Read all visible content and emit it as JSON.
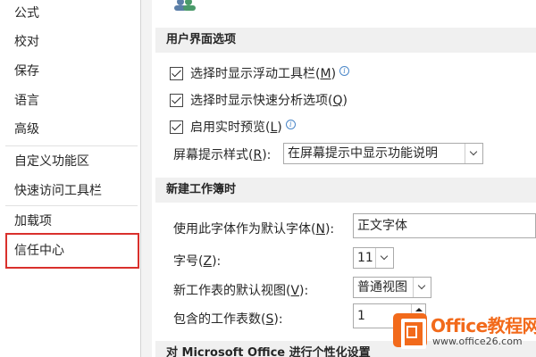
{
  "sidebar": {
    "items": [
      {
        "label": "公式"
      },
      {
        "label": "校对"
      },
      {
        "label": "保存"
      },
      {
        "label": "语言"
      },
      {
        "label": "高级"
      },
      {
        "label": "自定义功能区"
      },
      {
        "label": "快速访问工具栏"
      },
      {
        "label": "加载项"
      },
      {
        "label": "信任中心"
      }
    ],
    "selected": "信任中心"
  },
  "ui_options": {
    "header": "用户界面选项",
    "show_mini_toolbar": {
      "text": "选择时显示浮动工具栏(",
      "key": "M",
      "end": ")",
      "checked": true
    },
    "show_quick_analysis": {
      "text": "选择时显示快速分析选项(",
      "key": "Q",
      "end": ")",
      "checked": true
    },
    "live_preview": {
      "text": "启用实时预览(",
      "key": "L",
      "end": ")",
      "checked": true
    },
    "screentip_label": {
      "text": "屏幕提示样式(",
      "key": "R",
      "end": "):"
    },
    "screentip_value": "在屏幕提示中显示功能说明"
  },
  "new_workbook": {
    "header": "新建工作簿时",
    "font_label": {
      "text": "使用此字体作为默认字体(",
      "key": "N",
      "end": "):"
    },
    "font_value": "正文字体",
    "size_label": {
      "text": "字号(",
      "key": "Z",
      "end": "):"
    },
    "size_value": "11",
    "view_label": {
      "text": "新工作表的默认视图(",
      "key": "V",
      "end": "):"
    },
    "view_value": "普通视图",
    "sheets_label": {
      "text": "包含的工作表数(",
      "key": "S",
      "end": "):"
    },
    "sheets_value": "1"
  },
  "personalize": {
    "header": "对 Microsoft Office 进行个性化设置"
  },
  "watermark": {
    "title": "Office教程网",
    "url": "www.office26.com"
  },
  "colors": {
    "selected_border": "#d9302c",
    "info_icon": "#4a86c8",
    "watermark_orange": "#f26a1b"
  }
}
